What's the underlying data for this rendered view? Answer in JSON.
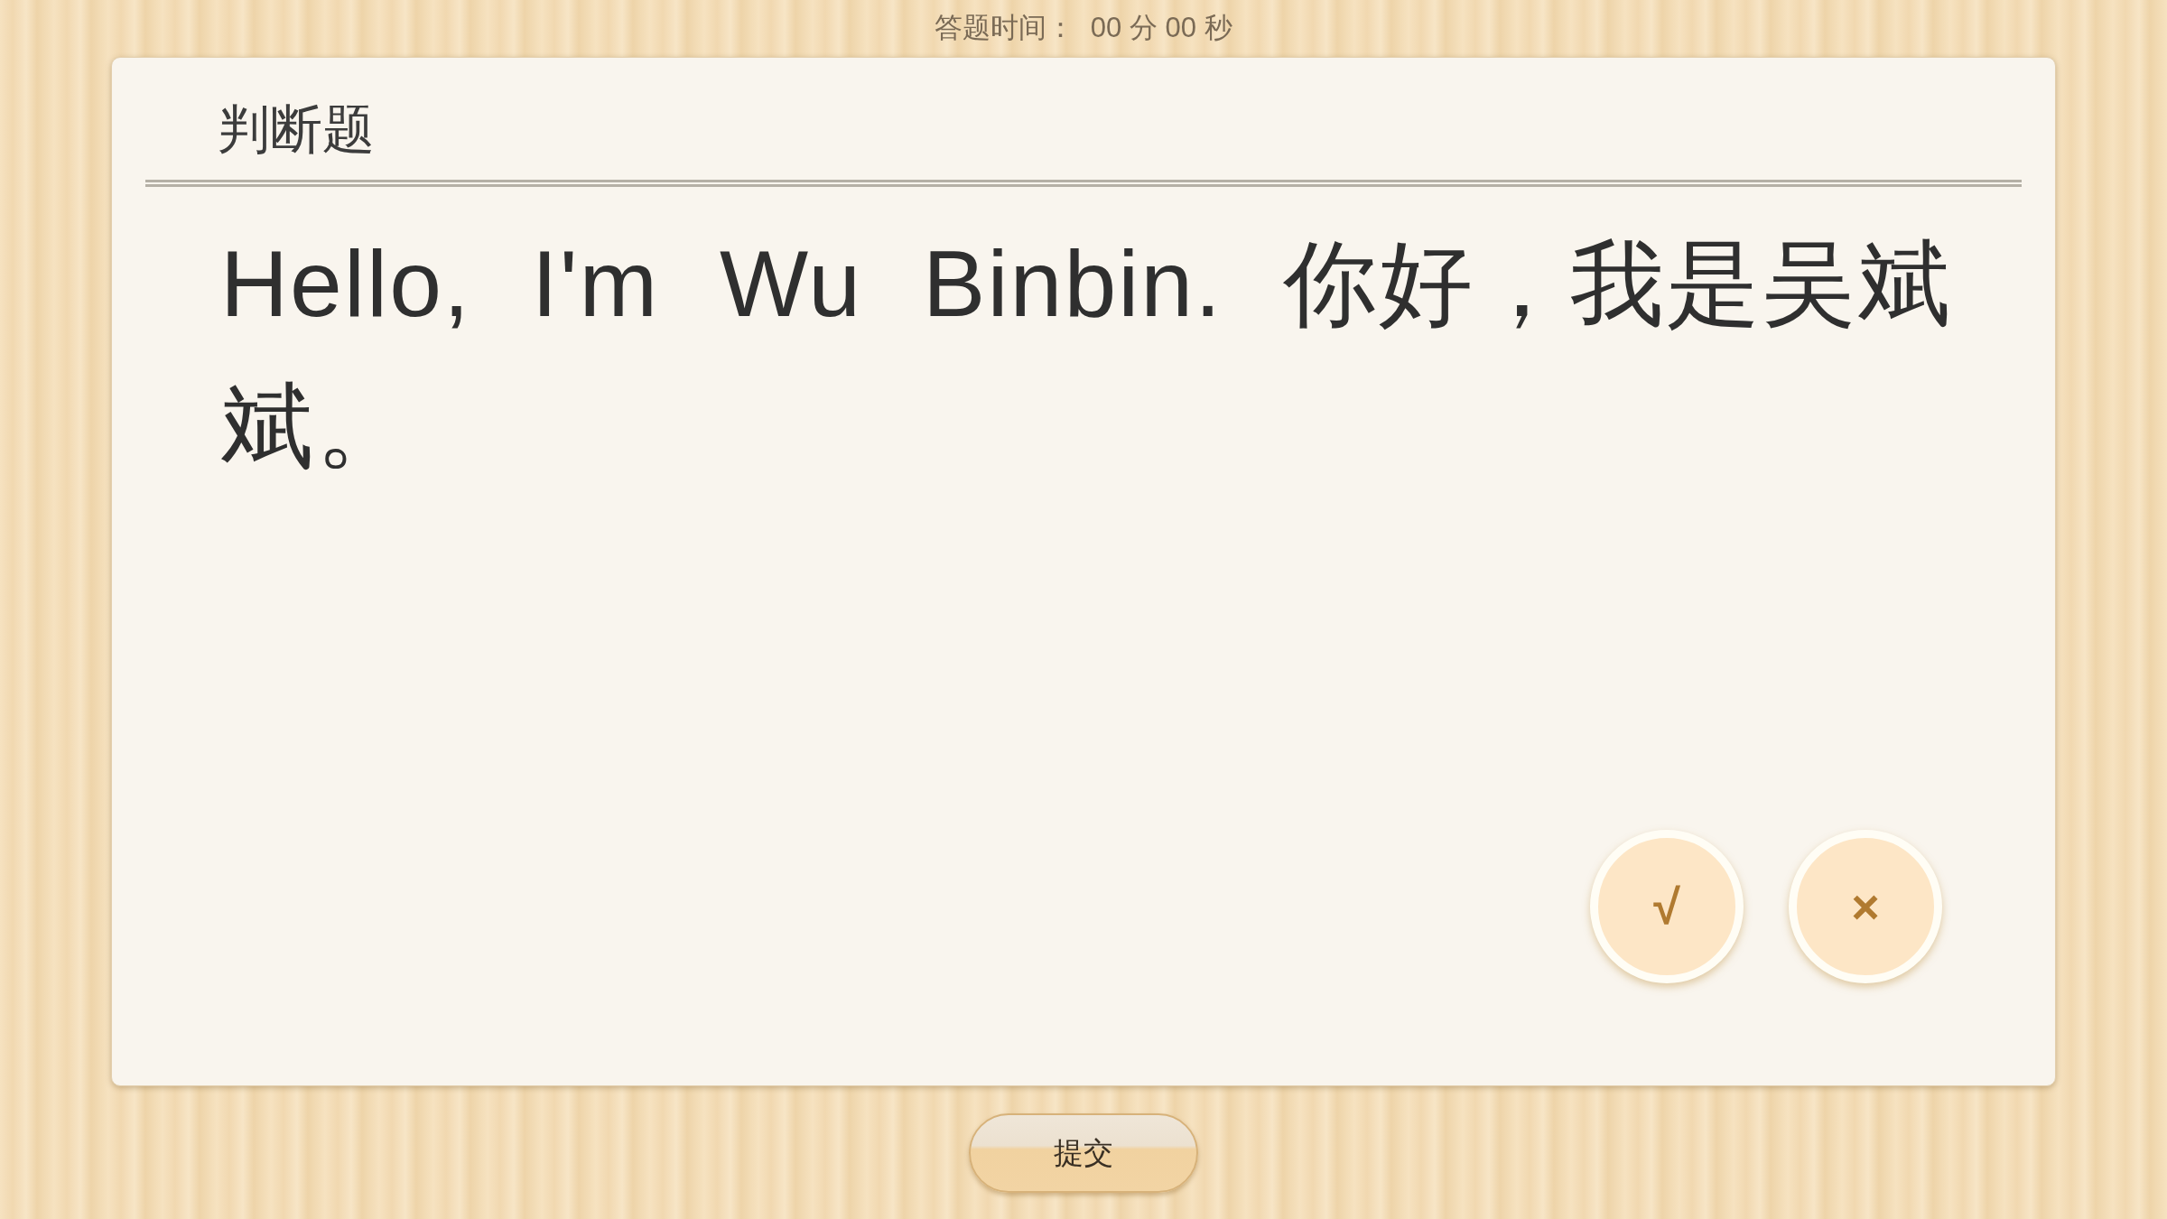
{
  "timer": "答题时间：  00 分 00 秒",
  "question": {
    "type": "判断题",
    "text": "Hello, I'm Wu Binbin. 你好，我是吴斌斌。"
  },
  "answers": [
    {
      "symbol": "√",
      "selected": false
    },
    {
      "symbol": "×",
      "selected": false
    }
  ],
  "submit_button": "提交"
}
